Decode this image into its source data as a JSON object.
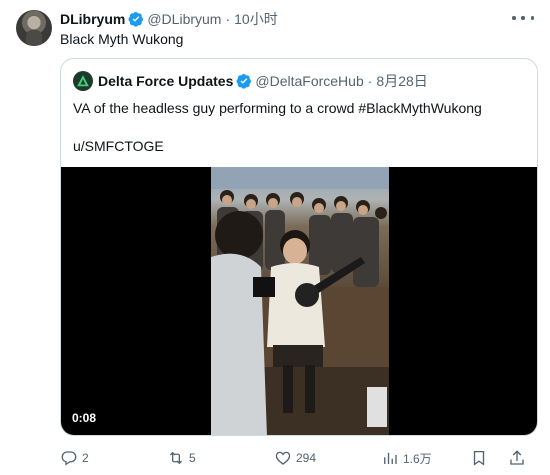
{
  "author": {
    "display_name": "DLibryum",
    "handle": "@DLibryum",
    "separator": "·",
    "time": "10小时"
  },
  "tweet_text": "Black Myth Wukong",
  "quoted": {
    "display_name": "Delta Force Updates",
    "handle": "@DeltaForceHub",
    "separator": "·",
    "time": "8月28日",
    "text_line1": "VA of the headless guy performing to a crowd #BlackMythWukong",
    "text_line2": "u/SMFCTOGE",
    "video_duration": "0:08"
  },
  "actions": {
    "replies": "2",
    "retweets": "5",
    "likes": "294",
    "views": "1.6万"
  },
  "colors": {
    "verified_blue": "#1d9bf0",
    "secondary_text": "#536471",
    "border": "#cfd9de"
  }
}
